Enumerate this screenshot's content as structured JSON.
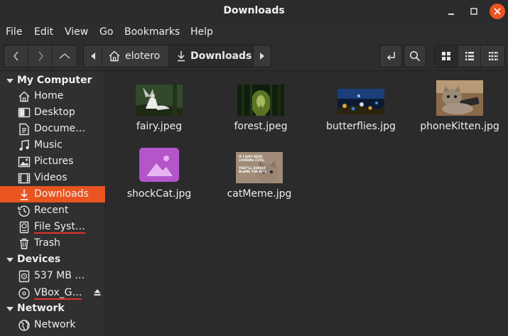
{
  "window": {
    "title": "Downloads"
  },
  "menubar": {
    "items": [
      "File",
      "Edit",
      "View",
      "Go",
      "Bookmarks",
      "Help"
    ]
  },
  "pathbar": {
    "segments": [
      {
        "label": "elotero",
        "icon": "home-icon"
      },
      {
        "label": "Downloads",
        "icon": "download-icon"
      }
    ]
  },
  "sidebar": {
    "sections": [
      {
        "label": "My Computer",
        "items": [
          {
            "label": "Home",
            "icon": "home-icon"
          },
          {
            "label": "Desktop",
            "icon": "desktop-icon"
          },
          {
            "label": "Docume…",
            "icon": "document-icon"
          },
          {
            "label": "Music",
            "icon": "music-icon"
          },
          {
            "label": "Pictures",
            "icon": "pictures-icon"
          },
          {
            "label": "Videos",
            "icon": "videos-icon"
          },
          {
            "label": "Downloads",
            "icon": "download-icon",
            "selected": true
          },
          {
            "label": "Recent",
            "icon": "recent-icon"
          },
          {
            "label": "File Syst…",
            "icon": "drive-icon"
          },
          {
            "label": "Trash",
            "icon": "trash-icon"
          }
        ]
      },
      {
        "label": "Devices",
        "items": [
          {
            "label": "537 MB …",
            "icon": "disc-icon"
          },
          {
            "label": "VBox_G…",
            "icon": "disc-icon",
            "eject": true
          }
        ]
      },
      {
        "label": "Network",
        "items": [
          {
            "label": "Network",
            "icon": "network-icon"
          }
        ]
      }
    ]
  },
  "files": [
    {
      "name": "fairy.jpeg"
    },
    {
      "name": "forest.jpeg"
    },
    {
      "name": "butterflies.jpg"
    },
    {
      "name": "phoneKitten.jpg"
    },
    {
      "name": "shockCat.jpg"
    },
    {
      "name": "catMeme.jpg",
      "caption_lines": [
        "IF I JUST KEEP",
        "LOOKING CUTE,",
        "THEY'LL SURELY",
        "BLAME THE DOG"
      ]
    }
  ],
  "colors": {
    "accent": "#e95420",
    "sidebar_bg": "#303030",
    "content_bg": "#2b2b2b",
    "image_placeholder": "#b455c9"
  }
}
